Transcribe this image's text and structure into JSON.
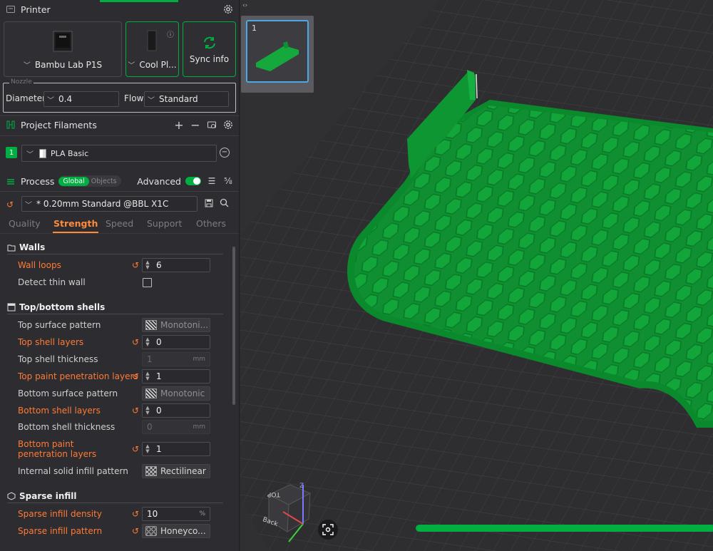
{
  "printer": {
    "title": "Printer",
    "printer_name": "Bambu Lab P1S",
    "plate_name": "Cool Pl...",
    "sync_label": "Sync info"
  },
  "nozzle": {
    "legend": "Nozzle",
    "diameter_label": "Diameter",
    "diameter_value": "0.4",
    "flow_label": "Flow",
    "flow_value": "Standard"
  },
  "filaments": {
    "title": "Project Filaments",
    "items": [
      {
        "index": "1",
        "name": "PLA Basic",
        "color": "#00ae42"
      }
    ]
  },
  "process": {
    "title": "Process",
    "scope_global": "Global",
    "scope_objects": "Objects",
    "advanced_label": "Advanced",
    "preset": "* 0.20mm Standard @BBL X1C",
    "tabs": [
      "Quality",
      "Strength",
      "Speed",
      "Support",
      "Others"
    ],
    "active_tab": "Strength"
  },
  "settings": {
    "walls": {
      "title": "Walls",
      "wall_loops_label": "Wall loops",
      "wall_loops_value": "6",
      "detect_thin_wall_label": "Detect thin wall"
    },
    "top_bottom": {
      "title": "Top/bottom shells",
      "top_surface_pattern_label": "Top surface pattern",
      "top_surface_pattern_value": "Monotoni...",
      "top_shell_layers_label": "Top shell layers",
      "top_shell_layers_value": "0",
      "top_shell_thickness_label": "Top shell thickness",
      "top_shell_thickness_value": "1",
      "top_paint_label": "Top paint penetration layers",
      "top_paint_value": "1",
      "bottom_surface_pattern_label": "Bottom surface pattern",
      "bottom_surface_pattern_value": "Monotonic",
      "bottom_shell_layers_label": "Bottom shell layers",
      "bottom_shell_layers_value": "0",
      "bottom_shell_thickness_label": "Bottom shell thickness",
      "bottom_shell_thickness_value": "0",
      "bottom_paint_label": "Bottom paint penetration layers",
      "bottom_paint_value": "1",
      "internal_solid_label": "Internal solid infill pattern",
      "internal_solid_value": "Rectilinear"
    },
    "sparse": {
      "title": "Sparse infill",
      "density_label": "Sparse infill density",
      "density_value": "10",
      "pattern_label": "Sparse infill pattern",
      "pattern_value": "Honeyco..."
    },
    "units": {
      "mm": "mm",
      "percent": "%"
    }
  },
  "viewport": {
    "plate_number": "1",
    "cube_top": "TOP",
    "cube_back": "Back",
    "axis_z": "Z",
    "colors": {
      "model": "#0e9a35",
      "bed": "#2e2e31",
      "accent": "#00ae42"
    }
  }
}
